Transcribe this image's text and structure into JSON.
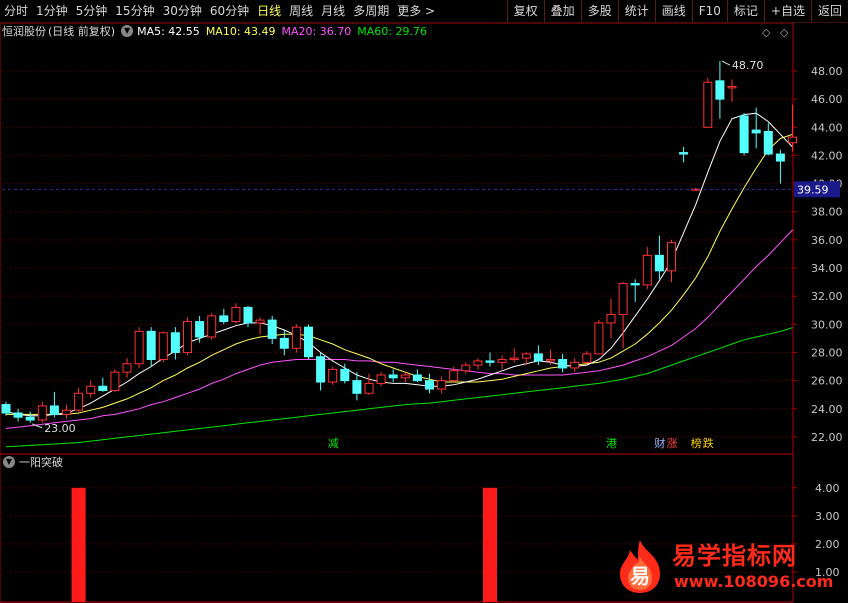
{
  "toolbar": {
    "periods": [
      "分时",
      "1分钟",
      "5分钟",
      "15分钟",
      "30分钟",
      "60分钟",
      "日线",
      "周线",
      "月线",
      "多周期",
      "更多 >"
    ],
    "active_period": "日线",
    "buttons": [
      "复权",
      "叠加",
      "多股",
      "统计",
      "画线",
      "F10",
      "标记",
      "+自选",
      "返回"
    ]
  },
  "infobar": {
    "stock_name": "恒润股份",
    "mode": "(日线 前复权)",
    "ma5_label": "MA5: 42.55",
    "ma10_label": "MA10: 43.49",
    "ma20_label": "MA20: 36.70",
    "ma60_label": "MA60: 29.76"
  },
  "indicator": {
    "name": "一阳突破"
  },
  "colors": {
    "up": "#ff3232",
    "down": "#54ffff",
    "ma5": "#ffffff",
    "ma10": "#ffff54",
    "ma20": "#ff54ff",
    "ma60": "#00e600",
    "axis": "#b40000",
    "grid": "#4a0000",
    "price_tag_bg": "#1a1a8a",
    "signal": "#ff1a1a"
  },
  "markers": [
    {
      "text": "减",
      "color": "#00e600",
      "pos": 27
    },
    {
      "text": "港",
      "color": "#00e600",
      "pos": 50
    },
    {
      "text": "财",
      "color": "#9fb4ff",
      "pos": 54
    },
    {
      "text": "涨",
      "color": "#ff4040",
      "pos": 55
    },
    {
      "text": "榜",
      "color": "#ffd200",
      "pos": 57
    },
    {
      "text": "跌",
      "color": "#ffd200",
      "pos": 58
    }
  ],
  "annotations": {
    "high_label": "48.70",
    "low_label": "23.00"
  },
  "price_tag": "39.59",
  "watermark": {
    "text": "易学指标网",
    "url": "www.108096.com",
    "logo_char": "易"
  },
  "chart_data": [
    {
      "type": "candlestick",
      "title": "恒润股份 (日线 前复权)",
      "y_ticks": [
        "48.00",
        "46.00",
        "44.00",
        "42.00",
        "40.00",
        "38.00",
        "36.00",
        "34.00",
        "32.00",
        "30.00",
        "28.00",
        "26.00",
        "24.00",
        "22.00"
      ],
      "ylim": [
        21.0,
        50.2
      ],
      "candles": [
        [
          24.3,
          24.5,
          23.5,
          23.7
        ],
        [
          23.7,
          24.0,
          23.1,
          23.4
        ],
        [
          23.4,
          23.8,
          23.0,
          23.2
        ],
        [
          23.2,
          24.5,
          23.0,
          24.2
        ],
        [
          24.2,
          25.2,
          23.4,
          23.6
        ],
        [
          23.6,
          24.3,
          23.3,
          23.9
        ],
        [
          23.9,
          25.5,
          23.8,
          25.1
        ],
        [
          25.1,
          26.0,
          24.8,
          25.6
        ],
        [
          25.6,
          26.2,
          25.2,
          25.3
        ],
        [
          25.3,
          26.8,
          25.2,
          26.6
        ],
        [
          26.6,
          27.6,
          26.2,
          27.2
        ],
        [
          27.2,
          29.8,
          26.9,
          29.5
        ],
        [
          29.5,
          29.8,
          27.0,
          27.5
        ],
        [
          27.5,
          29.5,
          27.3,
          29.4
        ],
        [
          29.4,
          29.8,
          27.5,
          28.0
        ],
        [
          28.0,
          30.5,
          27.8,
          30.2
        ],
        [
          30.2,
          30.6,
          28.7,
          29.1
        ],
        [
          29.1,
          30.8,
          28.9,
          30.6
        ],
        [
          30.6,
          31.1,
          30.0,
          30.2
        ],
        [
          30.2,
          31.5,
          30.1,
          31.2
        ],
        [
          31.2,
          31.3,
          29.8,
          30.1
        ],
        [
          30.1,
          30.5,
          29.3,
          30.3
        ],
        [
          30.3,
          30.6,
          28.6,
          29.0
        ],
        [
          29.0,
          29.6,
          27.8,
          28.3
        ],
        [
          28.3,
          30.0,
          28.0,
          29.8
        ],
        [
          29.8,
          30.0,
          27.5,
          27.7
        ],
        [
          27.7,
          28.0,
          25.3,
          25.9
        ],
        [
          25.9,
          27.0,
          25.7,
          26.8
        ],
        [
          26.8,
          27.2,
          25.8,
          26.0
        ],
        [
          26.0,
          26.6,
          24.6,
          25.1
        ],
        [
          25.1,
          26.5,
          25.0,
          25.8
        ],
        [
          25.8,
          26.6,
          25.6,
          26.4
        ],
        [
          26.4,
          26.8,
          25.9,
          26.2
        ],
        [
          26.2,
          26.6,
          25.9,
          26.4
        ],
        [
          26.4,
          26.8,
          25.9,
          26.0
        ],
        [
          26.0,
          26.5,
          25.1,
          25.4
        ],
        [
          25.4,
          26.3,
          25.1,
          26.0
        ],
        [
          26.0,
          27.0,
          25.9,
          26.7
        ],
        [
          26.7,
          27.3,
          26.5,
          27.1
        ],
        [
          27.1,
          27.6,
          26.8,
          27.4
        ],
        [
          27.4,
          28.0,
          27.0,
          27.3
        ],
        [
          27.3,
          27.8,
          26.8,
          27.5
        ],
        [
          27.5,
          28.3,
          27.3,
          27.6
        ],
        [
          27.6,
          28.0,
          27.1,
          27.9
        ],
        [
          27.9,
          28.5,
          27.1,
          27.4
        ],
        [
          27.4,
          28.2,
          27.1,
          27.5
        ],
        [
          27.5,
          27.9,
          26.6,
          26.9
        ],
        [
          26.9,
          27.6,
          26.6,
          27.3
        ],
        [
          27.3,
          28.1,
          27.2,
          27.9
        ],
        [
          27.9,
          30.3,
          27.9,
          30.1
        ],
        [
          30.1,
          31.8,
          29.0,
          30.7
        ],
        [
          30.7,
          33.0,
          28.3,
          32.9
        ],
        [
          32.9,
          33.2,
          31.6,
          32.8
        ],
        [
          32.8,
          35.5,
          32.5,
          34.9
        ],
        [
          34.9,
          36.3,
          33.2,
          33.8
        ],
        [
          33.8,
          36.0,
          33.0,
          35.8
        ],
        [
          42.2,
          42.6,
          41.5,
          42.1
        ],
        [
          39.6,
          39.7,
          39.5,
          39.6
        ],
        [
          44.0,
          47.5,
          44.0,
          47.2
        ],
        [
          47.3,
          48.7,
          44.6,
          46.0
        ],
        [
          46.8,
          47.4,
          45.8,
          46.9
        ],
        [
          44.8,
          45.0,
          42.0,
          42.2
        ],
        [
          43.8,
          45.4,
          42.5,
          43.6
        ],
        [
          43.7,
          44.3,
          42.0,
          42.1
        ],
        [
          42.1,
          42.4,
          40.0,
          41.6
        ],
        [
          42.9,
          45.6,
          42.3,
          43.3
        ]
      ],
      "ma5": [
        23.8,
        23.6,
        23.5,
        23.5,
        23.6,
        23.7,
        24.0,
        24.4,
        24.9,
        25.4,
        25.9,
        26.5,
        27.0,
        27.6,
        28.1,
        28.7,
        29.0,
        29.3,
        29.6,
        29.9,
        30.1,
        30.1,
        29.9,
        29.6,
        29.2,
        28.7,
        28.0,
        27.4,
        26.9,
        26.4,
        26.1,
        25.9,
        25.8,
        25.8,
        25.7,
        25.6,
        25.6,
        25.7,
        25.9,
        26.1,
        26.4,
        26.7,
        27.0,
        27.2,
        27.4,
        27.3,
        27.1,
        27.0,
        27.1,
        27.5,
        28.3,
        29.4,
        30.6,
        31.8,
        33.1,
        34.5,
        36.5,
        38.5,
        40.8,
        43.0,
        44.6,
        44.9,
        45.0,
        44.4,
        43.5,
        42.6
      ],
      "ma10": [
        23.6,
        23.6,
        23.6,
        23.6,
        23.6,
        23.6,
        23.7,
        23.9,
        24.1,
        24.4,
        24.7,
        25.1,
        25.5,
        26.0,
        26.4,
        26.9,
        27.3,
        27.8,
        28.2,
        28.6,
        28.9,
        29.1,
        29.2,
        29.3,
        29.3,
        29.2,
        28.9,
        28.6,
        28.2,
        27.9,
        27.6,
        27.2,
        26.9,
        26.6,
        26.3,
        26.1,
        25.9,
        25.9,
        25.9,
        25.9,
        26.0,
        26.1,
        26.3,
        26.5,
        26.7,
        26.9,
        27.0,
        27.1,
        27.2,
        27.3,
        27.6,
        28.1,
        28.6,
        29.3,
        30.1,
        31.0,
        32.1,
        33.3,
        34.8,
        36.6,
        38.2,
        39.7,
        41.1,
        42.4,
        43.2,
        43.5
      ],
      "ma20": [
        22.6,
        22.7,
        22.8,
        22.9,
        23.0,
        23.1,
        23.2,
        23.3,
        23.5,
        23.6,
        23.8,
        24.0,
        24.3,
        24.5,
        24.8,
        25.1,
        25.4,
        25.8,
        26.1,
        26.5,
        26.8,
        27.1,
        27.3,
        27.4,
        27.5,
        27.5,
        27.5,
        27.5,
        27.5,
        27.4,
        27.4,
        27.3,
        27.3,
        27.2,
        27.1,
        27.0,
        26.9,
        26.8,
        26.7,
        26.6,
        26.5,
        26.5,
        26.4,
        26.4,
        26.4,
        26.4,
        26.4,
        26.5,
        26.6,
        26.7,
        26.9,
        27.1,
        27.4,
        27.7,
        28.1,
        28.5,
        29.1,
        29.7,
        30.5,
        31.4,
        32.3,
        33.2,
        34.1,
        34.9,
        35.8,
        36.7
      ],
      "ma60": [
        21.3,
        21.35,
        21.4,
        21.45,
        21.5,
        21.55,
        21.6,
        21.7,
        21.8,
        21.9,
        22.0,
        22.1,
        22.2,
        22.3,
        22.4,
        22.5,
        22.6,
        22.7,
        22.8,
        22.9,
        23.0,
        23.1,
        23.2,
        23.3,
        23.4,
        23.5,
        23.6,
        23.7,
        23.8,
        23.9,
        24.0,
        24.1,
        24.2,
        24.3,
        24.35,
        24.4,
        24.5,
        24.6,
        24.7,
        24.8,
        24.9,
        25.0,
        25.1,
        25.2,
        25.3,
        25.4,
        25.5,
        25.6,
        25.7,
        25.8,
        25.95,
        26.1,
        26.3,
        26.5,
        26.8,
        27.1,
        27.4,
        27.7,
        28.0,
        28.3,
        28.6,
        28.9,
        29.1,
        29.3,
        29.5,
        29.76
      ]
    },
    {
      "type": "bar",
      "title": "一阳突破",
      "y_ticks": [
        "4.00",
        "3.00",
        "2.00",
        "1.00"
      ],
      "ylim": [
        0,
        4.6
      ],
      "signals": [
        {
          "candle": 6,
          "value": 4.0
        },
        {
          "candle": 40,
          "value": 4.0
        }
      ]
    }
  ]
}
